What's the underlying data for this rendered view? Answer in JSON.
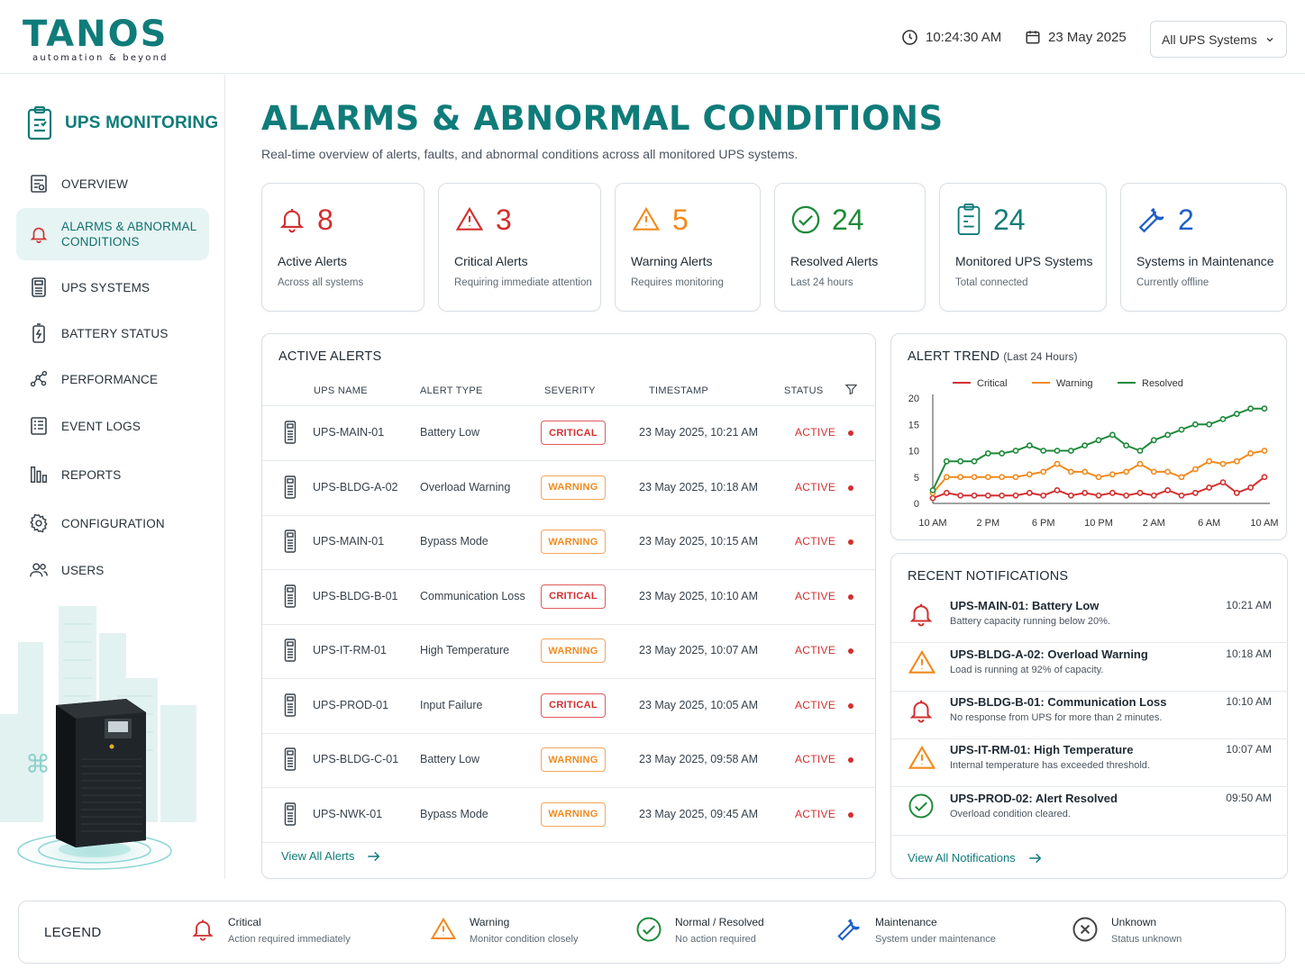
{
  "header": {
    "logo_main": "TANOS",
    "logo_sub": "automation & beyond",
    "time": "10:24:30 AM",
    "date": "23 May 2025",
    "system_select": "All UPS Systems"
  },
  "sidebar": {
    "title": "UPS MONITORING",
    "items": [
      {
        "label": "OVERVIEW",
        "icon": "report-icon"
      },
      {
        "label": "ALARMS & ABNORMAL CONDITIONS",
        "icon": "bell-icon"
      },
      {
        "label": "UPS SYSTEMS",
        "icon": "ups-icon"
      },
      {
        "label": "BATTERY STATUS",
        "icon": "battery-icon"
      },
      {
        "label": "PERFORMANCE",
        "icon": "performance-icon"
      },
      {
        "label": "EVENT LOGS",
        "icon": "log-icon"
      },
      {
        "label": "REPORTS",
        "icon": "bars-icon"
      },
      {
        "label": "CONFIGURATION",
        "icon": "gear-icon"
      },
      {
        "label": "USERS",
        "icon": "users-icon"
      }
    ]
  },
  "page": {
    "title": "ALARMS & ABNORMAL CONDITIONS",
    "subtitle": "Real-time overview of alerts, faults, and abnormal conditions across all monitored UPS systems."
  },
  "stats": [
    {
      "value": "8",
      "label": "Active Alerts",
      "desc": "Across all systems",
      "color": "#d32f2f",
      "icon": "bell-icon"
    },
    {
      "value": "3",
      "label": "Critical Alerts",
      "desc": "Requiring immediate attention",
      "color": "#d32f2f",
      "icon": "alert-triangle-icon"
    },
    {
      "value": "5",
      "label": "Warning Alerts",
      "desc": "Requires monitoring",
      "color": "#f28a1e",
      "icon": "warning-triangle-icon"
    },
    {
      "value": "24",
      "label": "Resolved Alerts",
      "desc": "Last 24 hours",
      "color": "#1e8a3a",
      "icon": "check-circle-icon"
    },
    {
      "value": "24",
      "label": "Monitored UPS Systems",
      "desc": "Total connected",
      "color": "#0f7c7a",
      "icon": "ups-icon"
    },
    {
      "value": "2",
      "label": "Systems in Maintenance",
      "desc": "Currently offline",
      "color": "#1e5fc8",
      "icon": "wrench-icon"
    }
  ],
  "alerts": {
    "title": "ACTIVE ALERTS",
    "columns": [
      "UPS NAME",
      "ALERT TYPE",
      "SEVERITY",
      "TIMESTAMP",
      "STATUS"
    ],
    "rows": [
      {
        "name": "UPS-MAIN-01",
        "type": "Battery Low",
        "severity": "CRITICAL",
        "timestamp": "23 May 2025, 10:21 AM",
        "status": "ACTIVE"
      },
      {
        "name": "UPS-BLDG-A-02",
        "type": "Overload Warning",
        "severity": "WARNING",
        "timestamp": "23 May 2025, 10:18 AM",
        "status": "ACTIVE"
      },
      {
        "name": "UPS-MAIN-01",
        "type": "Bypass Mode",
        "severity": "WARNING",
        "timestamp": "23 May 2025, 10:15 AM",
        "status": "ACTIVE"
      },
      {
        "name": "UPS-BLDG-B-01",
        "type": "Communication Loss",
        "severity": "CRITICAL",
        "timestamp": "23 May 2025, 10:10 AM",
        "status": "ACTIVE"
      },
      {
        "name": "UPS-IT-RM-01",
        "type": "High Temperature",
        "severity": "WARNING",
        "timestamp": "23 May 2025, 10:07 AM",
        "status": "ACTIVE"
      },
      {
        "name": "UPS-PROD-01",
        "type": "Input Failure",
        "severity": "CRITICAL",
        "timestamp": "23 May 2025, 10:05 AM",
        "status": "ACTIVE"
      },
      {
        "name": "UPS-BLDG-C-01",
        "type": "Battery Low",
        "severity": "WARNING",
        "timestamp": "23 May 2025, 09:58 AM",
        "status": "ACTIVE"
      },
      {
        "name": "UPS-NWK-01",
        "type": "Bypass Mode",
        "severity": "WARNING",
        "timestamp": "23 May 2025, 09:45 AM",
        "status": "ACTIVE"
      }
    ],
    "view_all": "View All Alerts"
  },
  "trend": {
    "title": "ALERT TREND",
    "title_suffix": "(Last 24 Hours)"
  },
  "chart_data": {
    "type": "line",
    "title": "ALERT TREND (Last 24 Hours)",
    "x": [
      "10 AM",
      "11 AM",
      "12 PM",
      "1 PM",
      "2 PM",
      "3 PM",
      "4 PM",
      "5 PM",
      "6 PM",
      "7 PM",
      "8 PM",
      "9 PM",
      "10 PM",
      "11 PM",
      "12 AM",
      "1 AM",
      "2 AM",
      "3 AM",
      "4 AM",
      "5 AM",
      "6 AM",
      "7 AM",
      "8 AM",
      "9 AM",
      "10 AM"
    ],
    "xticks": [
      "10 AM",
      "2 PM",
      "6 PM",
      "10 PM",
      "2 AM",
      "6 AM",
      "10 AM"
    ],
    "yticks": [
      0,
      5,
      10,
      15,
      20
    ],
    "ylim": [
      0,
      20
    ],
    "legend_position": "top",
    "series": [
      {
        "name": "Critical",
        "color": "#d32f2f",
        "values": [
          1,
          2,
          1.5,
          1.5,
          1.5,
          1.5,
          1.5,
          2,
          1.5,
          2.5,
          1.5,
          2,
          1.5,
          2,
          1.5,
          2,
          1.5,
          2.5,
          1.5,
          2,
          3,
          4,
          2,
          3,
          5
        ]
      },
      {
        "name": "Warning",
        "color": "#f28a1e",
        "values": [
          2,
          5,
          5,
          5,
          5,
          5,
          5,
          5.5,
          6,
          7.5,
          6,
          6,
          5,
          5.5,
          6,
          7.5,
          6,
          6,
          5,
          6.5,
          8,
          7.5,
          8,
          9.5,
          10
        ]
      },
      {
        "name": "Resolved",
        "color": "#1e8a3a",
        "values": [
          2.5,
          8,
          8,
          8,
          9.5,
          9.5,
          10,
          11,
          10,
          10,
          10,
          11,
          12,
          13,
          11,
          10,
          12,
          13,
          14,
          15,
          15,
          16,
          17,
          18,
          18
        ]
      }
    ]
  },
  "notifications": {
    "title": "RECENT NOTIFICATIONS",
    "items": [
      {
        "title": "UPS-MAIN-01: Battery Low",
        "desc": "Battery capacity running below 20%.",
        "time": "10:21 AM",
        "icon": "bell-icon",
        "color": "#d32f2f"
      },
      {
        "title": "UPS-BLDG-A-02: Overload Warning",
        "desc": "Load is running at 92% of capacity.",
        "time": "10:18 AM",
        "icon": "warning-triangle-icon",
        "color": "#f28a1e"
      },
      {
        "title": "UPS-BLDG-B-01: Communication Loss",
        "desc": "No response from UPS for more than 2 minutes.",
        "time": "10:10 AM",
        "icon": "bell-icon",
        "color": "#d32f2f"
      },
      {
        "title": "UPS-IT-RM-01: High Temperature",
        "desc": "Internal temperature has exceeded threshold.",
        "time": "10:07 AM",
        "icon": "warning-triangle-icon",
        "color": "#f28a1e"
      },
      {
        "title": "UPS-PROD-02: Alert Resolved",
        "desc": "Overload condition cleared.",
        "time": "09:50 AM",
        "icon": "check-circle-icon",
        "color": "#1e8a3a"
      }
    ],
    "view_all": "View All Notifications"
  },
  "legend": {
    "title": "LEGEND",
    "items": [
      {
        "name": "Critical",
        "desc": "Action required immediately",
        "icon": "bell-icon",
        "color": "#d32f2f"
      },
      {
        "name": "Warning",
        "desc": "Monitor condition closely",
        "icon": "warning-triangle-icon",
        "color": "#f28a1e"
      },
      {
        "name": "Normal / Resolved",
        "desc": "No action required",
        "icon": "check-circle-icon",
        "color": "#1e8a3a"
      },
      {
        "name": "Maintenance",
        "desc": "System under maintenance",
        "icon": "wrench-icon",
        "color": "#1e5fc8"
      },
      {
        "name": "Unknown",
        "desc": "Status unknown",
        "icon": "x-circle-icon",
        "color": "#444444"
      }
    ]
  }
}
